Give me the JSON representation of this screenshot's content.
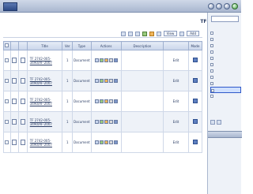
{
  "topbar": {
    "crumbs": [
      "",
      "",
      "",
      "",
      ""
    ],
    "nav_label": "",
    "nav_buttons": [
      "back-icon",
      "forward-icon",
      "up-icon",
      "refresh-icon"
    ]
  },
  "content": {
    "title": "TF : Content"
  },
  "toolbar": {
    "view_label": "View",
    "add_label": "Add"
  },
  "table": {
    "headers": [
      "",
      "",
      "",
      "Title",
      "Ver",
      "Type",
      "Actions",
      "Description",
      "",
      "Mode"
    ],
    "rows": [
      {
        "title_line1": "TF 2742-005-",
        "title_line2": "3490/AF-2007",
        "ver": "1",
        "type": "Document",
        "description": "",
        "mode": "Edit"
      },
      {
        "title_line1": "TF 2742-005-",
        "title_line2": "3490/AF-2007",
        "ver": "1",
        "type": "Document",
        "description": "",
        "mode": "Edit"
      },
      {
        "title_line1": "TF 2742-005-",
        "title_line2": "3490/AF-2007",
        "ver": "1",
        "type": "Document",
        "description": "",
        "mode": "Edit"
      },
      {
        "title_line1": "TF 2742-005-",
        "title_line2": "3490/AF-2007",
        "ver": "1",
        "type": "Document",
        "description": "",
        "mode": "Edit"
      },
      {
        "title_line1": "TF 2742-005-",
        "title_line2": "3490/AF-2007",
        "ver": "1",
        "type": "Document",
        "description": "",
        "mode": "Edit"
      }
    ]
  },
  "sidebar": {
    "tree": [
      {
        "label": ""
      },
      {
        "label": ""
      },
      {
        "label": ""
      },
      {
        "label": ""
      },
      {
        "label": ""
      },
      {
        "label": ""
      },
      {
        "label": ""
      },
      {
        "label": ""
      },
      {
        "label": ""
      },
      {
        "label": ""
      },
      {
        "label": ""
      }
    ],
    "selected_index": 9,
    "panel_title": "",
    "links": [
      "",
      "",
      "",
      "",
      "",
      "",
      ""
    ]
  },
  "colors": {
    "accent": "#2747a8",
    "header_bg": "#c9d5ea",
    "selected_bg": "#cfe0ff"
  }
}
